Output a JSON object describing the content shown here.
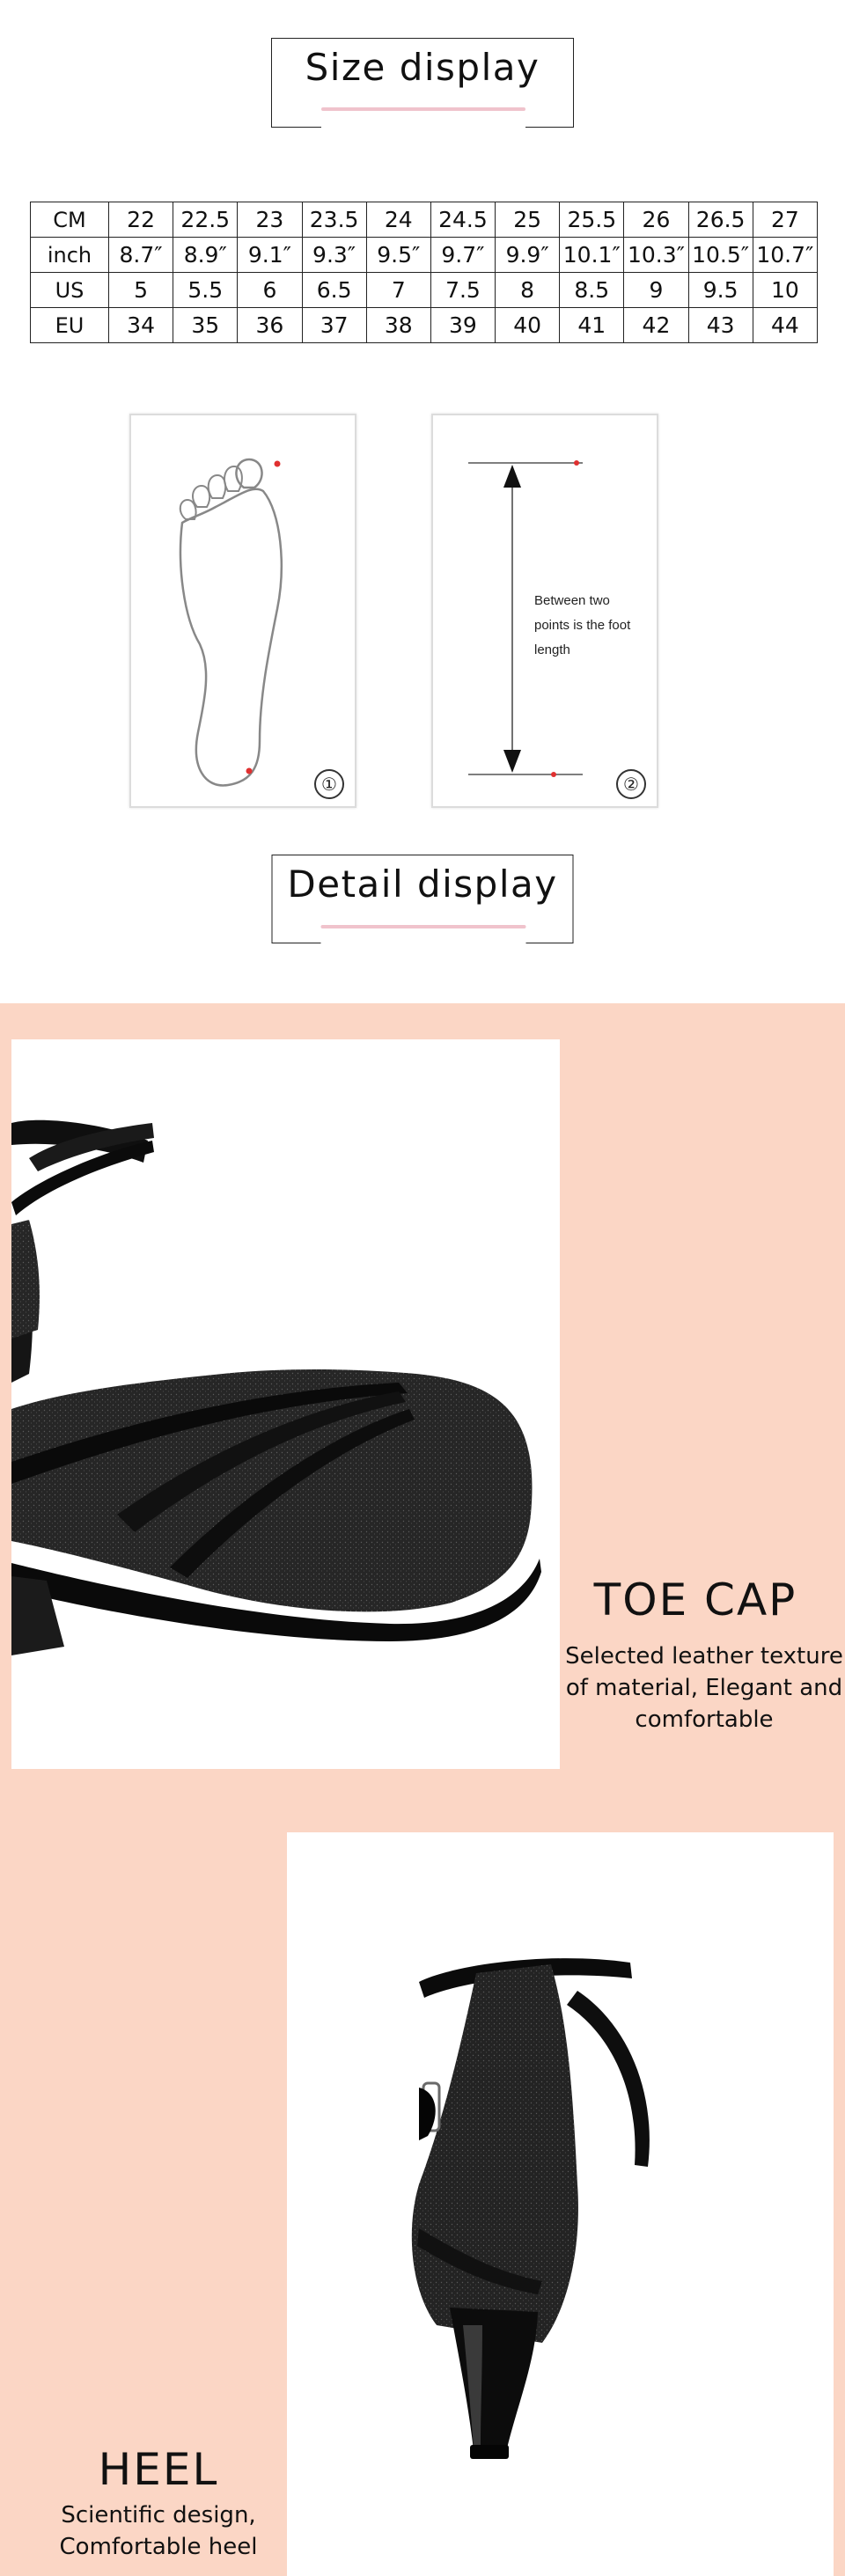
{
  "sections": {
    "size_title": "Size display",
    "detail_title": "Detail display"
  },
  "size_table": {
    "rows": [
      {
        "label": "CM",
        "values": [
          "22",
          "22.5",
          "23",
          "23.5",
          "24",
          "24.5",
          "25",
          "25.5",
          "26",
          "26.5",
          "27"
        ]
      },
      {
        "label": "inch",
        "values": [
          "8.7″",
          "8.9″",
          "9.1″",
          "9.3″",
          "9.5″",
          "9.7″",
          "9.9″",
          "10.1″",
          "10.3″",
          "10.5″",
          "10.7″"
        ]
      },
      {
        "label": "US",
        "values": [
          "5",
          "5.5",
          "6",
          "6.5",
          "7",
          "7.5",
          "8",
          "8.5",
          "9",
          "9.5",
          "10"
        ]
      },
      {
        "label": "EU",
        "values": [
          "34",
          "35",
          "36",
          "37",
          "38",
          "39",
          "40",
          "41",
          "42",
          "43",
          "44"
        ]
      }
    ]
  },
  "measure": {
    "card1_badge": "①",
    "card2_badge": "②",
    "between_text": "Between two points is the foot length"
  },
  "details": {
    "toe_cap": {
      "title": "TOE CAP",
      "description": "Selected leather texture of material, Elegant and comfortable"
    },
    "heel": {
      "title": "HEEL",
      "description": "Scientific design, Comfortable heel"
    }
  },
  "colors": {
    "peach_background": "#fbd6c5",
    "underline_pink": "#f0c3cc",
    "marker_red": "#e03030"
  }
}
